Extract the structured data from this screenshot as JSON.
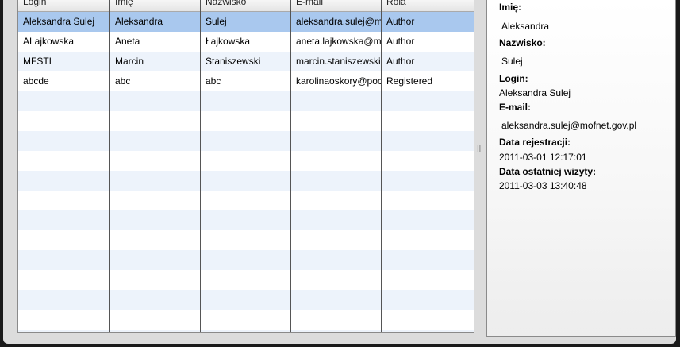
{
  "table": {
    "columns": [
      "Login",
      "Imię",
      "Nazwisko",
      "E-mail",
      "Rola"
    ],
    "rows": [
      {
        "login": "Aleksandra Sulej",
        "imie": "Aleksandra",
        "nazwisko": "Sulej",
        "email": "aleksandra.sulej@mofnet.gov.pl",
        "rola": "Author",
        "selected": true
      },
      {
        "login": "ALajkowska",
        "imie": "Aneta",
        "nazwisko": "Łajkowska",
        "email": "aneta.lajkowska@mofnet.gov.pl",
        "rola": "Author",
        "selected": false
      },
      {
        "login": "MFSTI",
        "imie": "Marcin",
        "nazwisko": "Staniszewski",
        "email": "marcin.staniszewski@mofnet.gov.pl",
        "rola": "Author",
        "selected": false
      },
      {
        "login": "abcde",
        "imie": "abc",
        "nazwisko": "abc",
        "email": "karolinaoskory@poczta.fm",
        "rola": "Registered",
        "selected": false
      }
    ]
  },
  "details": {
    "imie_label": "Imię:",
    "imie_value": "Aleksandra",
    "nazwisko_label": "Nazwisko:",
    "nazwisko_value": "Sulej",
    "login_label": "Login:",
    "login_value": "Aleksandra Sulej",
    "email_label": "E-mail:",
    "email_value": "aleksandra.sulej@mofnet.gov.pl",
    "registration_label": "Data rejestracji:",
    "registration_value": "2011-03-01 12:17:01",
    "last_visit_label": "Data ostatniej wizyty:",
    "last_visit_value": "2011-03-03 13:40:48"
  },
  "splitter": {
    "glyph": "|||"
  }
}
